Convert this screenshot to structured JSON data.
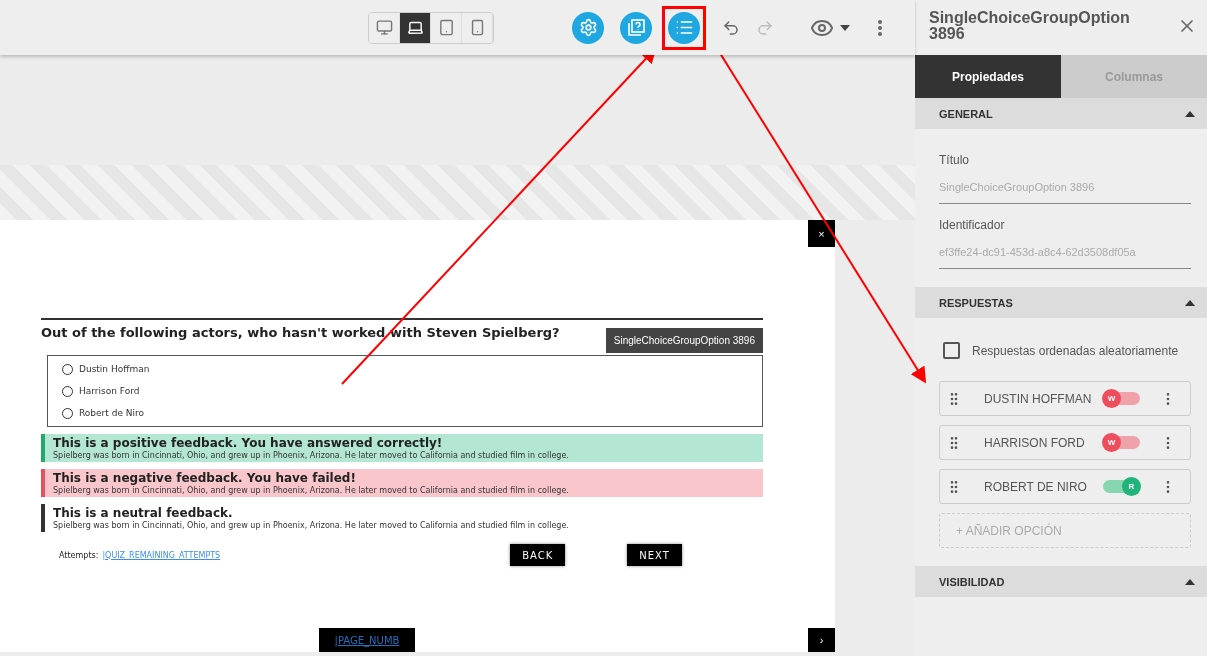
{
  "toolbar": {
    "devices": [
      {
        "kind": "desktop",
        "selected": false
      },
      {
        "kind": "laptop",
        "selected": true
      },
      {
        "kind": "tablet",
        "selected": false
      },
      {
        "kind": "phone",
        "selected": false
      }
    ],
    "actions": [
      {
        "kind": "settings",
        "highlighted": false
      },
      {
        "kind": "question",
        "highlighted": false
      },
      {
        "kind": "list",
        "highlighted": true
      }
    ]
  },
  "slide": {
    "close": "×",
    "question": "Out of the following actors, who hasn't worked with Steven Spielberg?",
    "tag": "SingleChoiceGroupOption 3896",
    "options": [
      {
        "label": "Dustin Hoffman",
        "selected": false
      },
      {
        "label": "Harrison Ford",
        "selected": false
      },
      {
        "label": "Robert de Niro",
        "selected": false
      }
    ],
    "feedbacks": [
      {
        "kind": "positive",
        "title": "This is a positive feedback. You have answered correctly!",
        "text": "Spielberg was born in Cincinnati, Ohio, and grew up in Phoenix, Arizona. He later moved to California and studied film in college."
      },
      {
        "kind": "negative",
        "title": "This is a negative feedback. You have failed!",
        "text": "Spielberg was born in Cincinnati, Ohio, and grew up in Phoenix, Arizona. He later moved to California and studied film in college."
      },
      {
        "kind": "neutral",
        "title": "This is a neutral feedback.",
        "text": "Spielberg was born in Cincinnati, Ohio, and grew up in Phoenix, Arizona. He later moved to California and studied film in college."
      }
    ],
    "attempts_label": "Attempts:",
    "attempts_link": "|QUIZ_REMAINING_ATTEMPTS",
    "back": "BACK",
    "next": "NEXT",
    "page_number": "|PAGE_NUMB",
    "next_arrow": "›"
  },
  "panel": {
    "title": "SingleChoiceGroupOption 3896",
    "tabs": [
      {
        "label": "Propiedades",
        "selected": true
      },
      {
        "label": "Columnas",
        "selected": false
      }
    ],
    "general": {
      "header": "GENERAL",
      "expanded": true,
      "fields": [
        {
          "label": "Título",
          "value": "SingleChoiceGroupOption 3896"
        },
        {
          "label": "Identificador",
          "value": "ef3ffe24-dc91-453d-a8c4-62d3508df05a"
        }
      ]
    },
    "answers": {
      "header": "RESPUESTAS",
      "expanded": true,
      "shuffle": {
        "label": "Respuestas ordenadas aleatoriamente",
        "checked": false
      },
      "items": [
        {
          "label": "DUSTIN HOFFMAN",
          "correct": false,
          "badge": "W"
        },
        {
          "label": "HARRISON FORD",
          "correct": false,
          "badge": "W"
        },
        {
          "label": "ROBERT DE NIRO",
          "correct": true,
          "badge": "R"
        }
      ],
      "add": "+ AÑADIR OPCIÓN"
    },
    "visibility": {
      "header": "VISIBILIDAD",
      "expanded": true
    }
  }
}
